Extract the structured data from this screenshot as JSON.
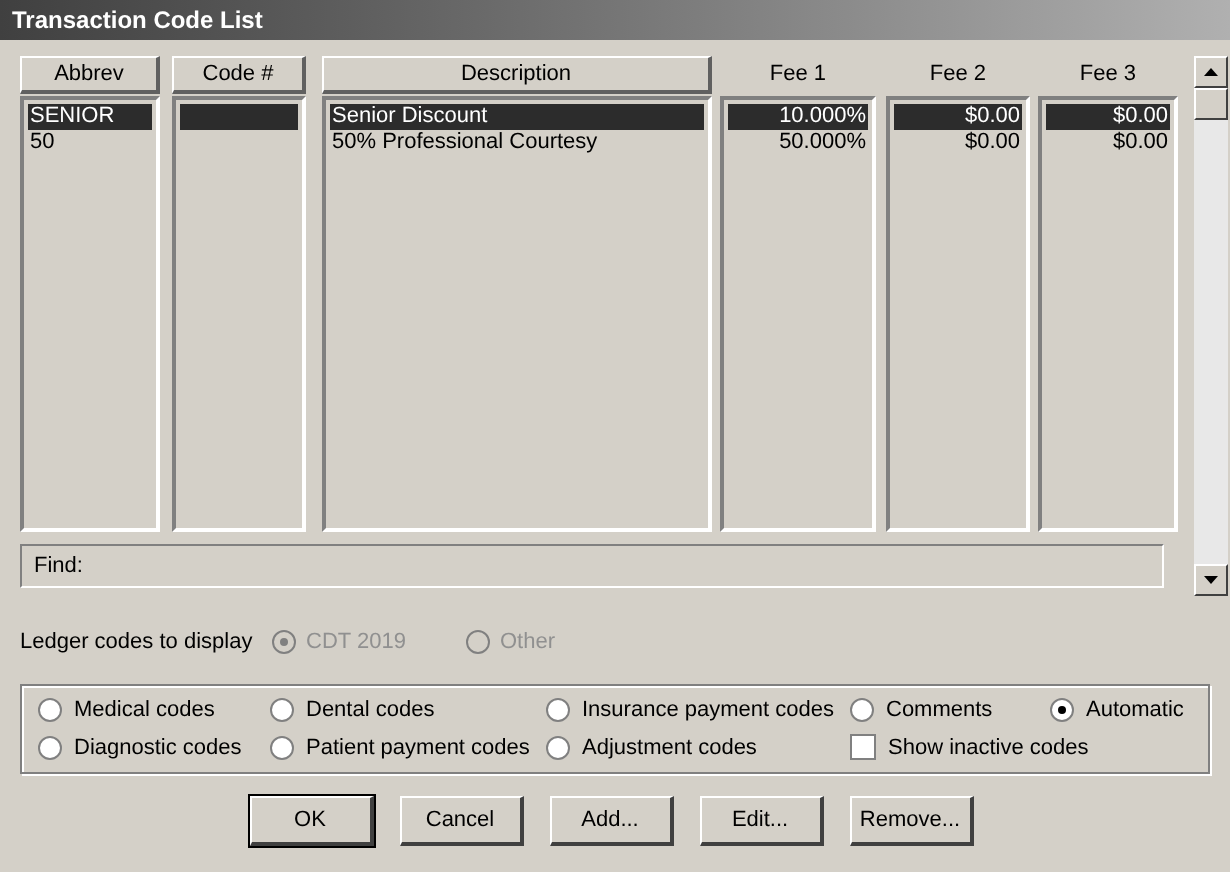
{
  "window": {
    "title": "Transaction Code List"
  },
  "columns": [
    {
      "label": "Abbrev",
      "kind": "button"
    },
    {
      "label": "Code #",
      "kind": "button"
    },
    {
      "label": "Description",
      "kind": "button"
    },
    {
      "label": "Fee 1",
      "kind": "label"
    },
    {
      "label": "Fee 2",
      "kind": "label"
    },
    {
      "label": "Fee 3",
      "kind": "label"
    }
  ],
  "rows": [
    {
      "abbrev": "SENIOR",
      "description": "Senior Discount",
      "fee_1": "10.000%",
      "fee_2": "$0.00",
      "fee_3": "$0.00",
      "selected": true
    },
    {
      "abbrev": "50",
      "description": "50% Professional Courtesy",
      "fee_1": "50.000%",
      "fee_2": "$0.00",
      "fee_3": "$0.00",
      "selected": false
    }
  ],
  "find": {
    "label": "Find:"
  },
  "ledger": {
    "label": "Ledger codes to display",
    "options": [
      {
        "label": "CDT 2019",
        "selected": true,
        "disabled": true
      },
      {
        "label": "Other",
        "selected": false,
        "disabled": true
      }
    ]
  },
  "filters": [
    {
      "label": "Medical codes",
      "kind": "radio",
      "checked": false
    },
    {
      "label": "Dental codes",
      "kind": "radio",
      "checked": false
    },
    {
      "label": "Insurance payment codes",
      "kind": "radio",
      "checked": false
    },
    {
      "label": "Comments",
      "kind": "radio",
      "checked": false
    },
    {
      "label": "Automatic",
      "kind": "radio",
      "checked": true
    },
    {
      "label": "Diagnostic codes",
      "kind": "radio",
      "checked": false
    },
    {
      "label": "Patient payment codes",
      "kind": "radio",
      "checked": false
    },
    {
      "label": "Adjustment codes",
      "kind": "radio",
      "checked": false
    },
    {
      "label": "Show inactive codes",
      "kind": "checkbox",
      "checked": false
    }
  ],
  "buttons": [
    {
      "label": "OK",
      "default": true
    },
    {
      "label": "Cancel",
      "default": false
    },
    {
      "label": "Add...",
      "default": false
    },
    {
      "label": "Edit...",
      "default": false
    },
    {
      "label": "Remove...",
      "default": false
    }
  ]
}
